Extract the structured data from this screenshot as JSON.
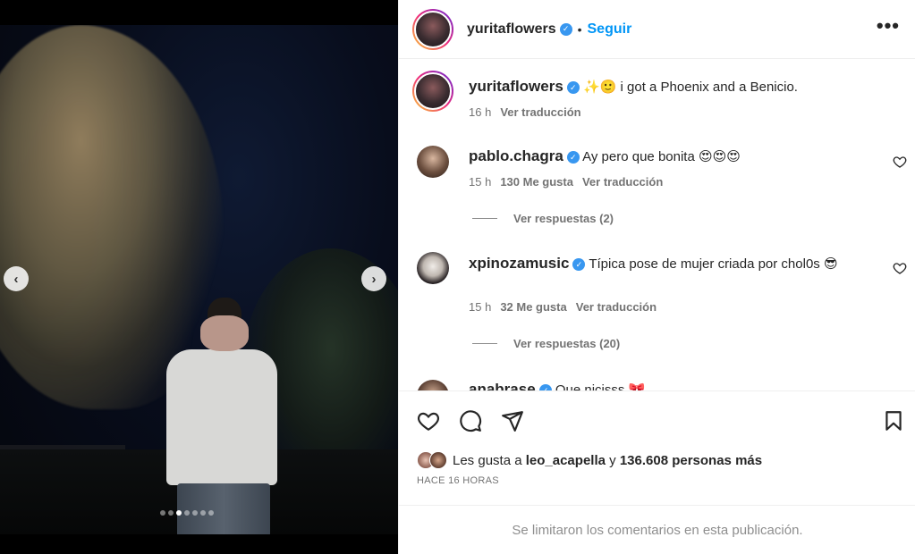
{
  "post": {
    "carousel": {
      "total_slides": 7,
      "active_slide": 3
    }
  },
  "header": {
    "username": "yuritaflowers",
    "separator": "•",
    "follow_label": "Seguir",
    "more_label": "•••"
  },
  "caption": {
    "username": "yuritaflowers",
    "text": "✨🙂 i got a Phoenix and a Benicio.",
    "time": "16 h",
    "translate": "Ver traducción"
  },
  "comments": [
    {
      "username": "pablo.chagra",
      "text": "Ay pero que bonita 😍😍😍",
      "time": "15 h",
      "likes": "130 Me gusta",
      "translate": "Ver traducción",
      "replies": "Ver respuestas (2)"
    },
    {
      "username": "xpinozamusic",
      "text": "Típica pose de mujer criada por chol0s 😎",
      "time": "15 h",
      "likes": "32 Me gusta",
      "translate": "Ver traducción",
      "replies": "Ver respuestas (20)"
    },
    {
      "username": "anabrase",
      "text": "Que nicisss 🎀"
    }
  ],
  "likes": {
    "prefix": "Les gusta a",
    "user": "leo_acapella",
    "joiner": "y",
    "others": "136.608 personas más"
  },
  "timestamp": "HACE 16 HORAS",
  "comments_limited": "Se limitaron los comentarios en esta publicación.",
  "colors": {
    "accent": "#0095f6",
    "verified": "#3897f0",
    "muted": "#737373"
  }
}
